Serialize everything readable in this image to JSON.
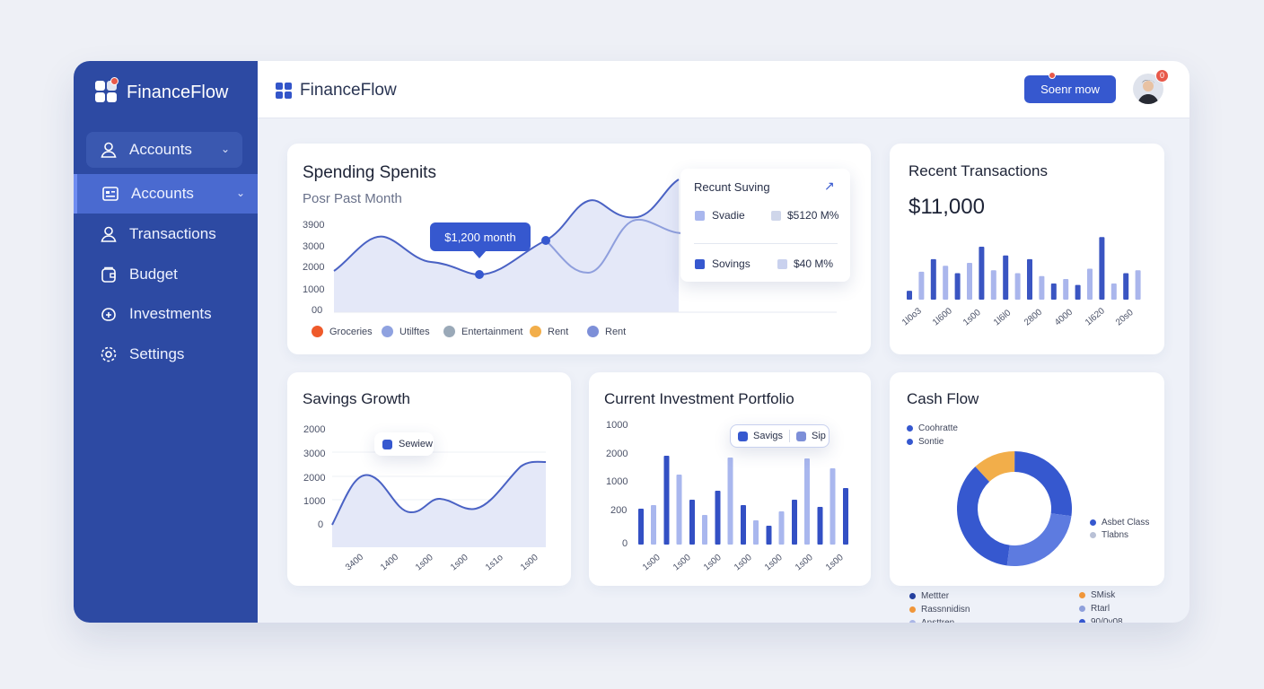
{
  "app": {
    "brand": "FinanceFlow"
  },
  "sidebar": {
    "items": [
      {
        "label": "Accounts",
        "icon": "user-icon",
        "expand": true,
        "style": "boxed"
      },
      {
        "label": "Accounts",
        "icon": "wallet-icon",
        "expand": true,
        "style": "active"
      },
      {
        "label": "Transactions",
        "icon": "user-icon"
      },
      {
        "label": "Budget",
        "icon": "budget-icon"
      },
      {
        "label": "Investments",
        "icon": "investment-icon"
      },
      {
        "label": "Settings",
        "icon": "gear-icon"
      }
    ]
  },
  "topbar": {
    "brand": "FinanceFlow",
    "cta": "Soenr mow",
    "notification_count": "0"
  },
  "spending": {
    "title": "Spending Spenits",
    "subtitle": "Posr Past Month",
    "yticks": [
      "3900",
      "3000",
      "2000",
      "1000",
      "00"
    ],
    "callout": "$1,200 month",
    "legend": [
      {
        "label": "Groceries",
        "color": "#ef5a2a"
      },
      {
        "label": "Utilftes",
        "color": "#8fa2e0"
      },
      {
        "label": "Entertainment",
        "color": "#9aa9b8"
      },
      {
        "label": "Rent",
        "color": "#f2ae4a"
      },
      {
        "label": "Rent",
        "color": "#7d8fd8"
      }
    ],
    "popup": {
      "title": "Recunt Suving",
      "rows": [
        {
          "label": "Svadie",
          "value": "$5120 M%",
          "c1": "#a9b7ee",
          "c2": "#cfd6ea"
        },
        {
          "label": "Sovings",
          "value": "$40 M%",
          "c1": "#3658cf",
          "c2": "#c9d1ee"
        }
      ]
    }
  },
  "recent": {
    "title": "Recent Transactions",
    "amount": "$11,000",
    "xlabels": [
      "1l0o3",
      "1l600",
      "1s00",
      "1l6l0",
      "2800",
      "4000",
      "1l620",
      "20s0"
    ],
    "values": [
      0.12,
      0.38,
      0.55,
      0.46,
      0.36,
      0.5,
      0.72,
      0.4,
      0.6,
      0.36,
      0.55,
      0.32,
      0.22,
      0.28,
      0.2,
      0.42,
      0.85,
      0.22,
      0.36,
      0.4
    ]
  },
  "savings": {
    "title": "Savings Growth",
    "yticks": [
      "2000",
      "3000",
      "2000",
      "1000",
      "0"
    ],
    "tooltip": "Sewiew",
    "xlabels": [
      "3400",
      "1400",
      "1s00",
      "1s00",
      "1s1o",
      "1s00"
    ]
  },
  "portfolio": {
    "title": "Current Investment Portfolio",
    "yticks": [
      "1000",
      "2000",
      "1000",
      "200",
      "0"
    ],
    "tip_a": "Savigs",
    "tip_b": "Sip",
    "xlabels": [
      "1s00",
      "1s00",
      "1s00",
      "1s00",
      "1s00",
      "1s00",
      "1s00"
    ],
    "values": [
      [
        0.4,
        0.44
      ],
      [
        0.99,
        0.78
      ],
      [
        0.5,
        0.33
      ],
      [
        0.6,
        0.97
      ],
      [
        0.44,
        0.27
      ],
      [
        0.21,
        0.37
      ],
      [
        0.5,
        0.96
      ],
      [
        0.42,
        0.85
      ],
      [
        0.63
      ]
    ]
  },
  "cashflow": {
    "title": "Cash Flow",
    "legend_top": [
      {
        "label": "Coohratte",
        "color": "#3658cf"
      },
      {
        "label": "Sontie",
        "color": "#3658cf"
      }
    ],
    "legend_right": [
      {
        "label": "Asbet Class",
        "color": "#3658cf"
      },
      {
        "label": "Tlabns",
        "color": "#b9c1d6"
      }
    ],
    "legend_bl": [
      {
        "label": "Mettter",
        "color": "#243f9e"
      },
      {
        "label": "Rassnnidisn",
        "color": "#f0963a"
      },
      {
        "label": "Ansttren",
        "color": "#aab6e6"
      }
    ],
    "legend_br": [
      {
        "label": "SMisk",
        "color": "#f0963a"
      },
      {
        "label": "Rtarl",
        "color": "#8fa0db"
      },
      {
        "label": "90/0v08",
        "color": "#3658cf"
      }
    ],
    "slices": [
      {
        "value": 0.12,
        "color": "#f2ae4a"
      },
      {
        "value": 0.27,
        "color": "#3658cf"
      },
      {
        "value": 0.25,
        "color": "#5d7be0"
      },
      {
        "value": 0.36,
        "color": "#3658cf"
      }
    ]
  }
}
